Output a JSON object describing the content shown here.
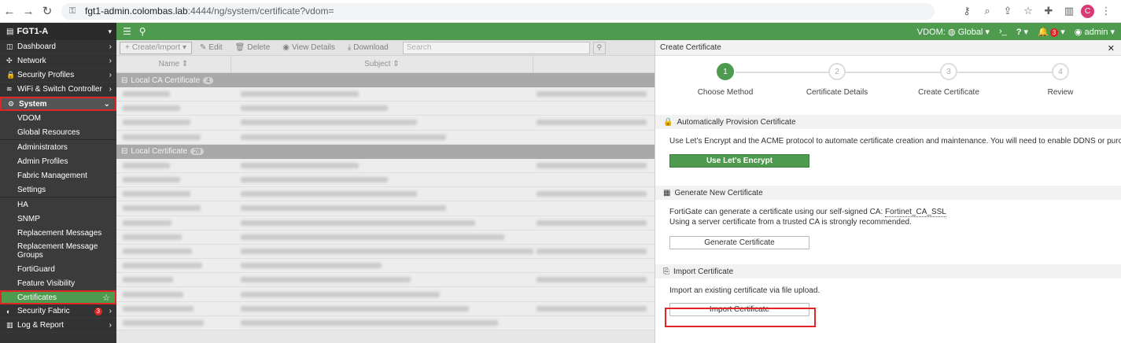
{
  "browser": {
    "url_host": "fgt1-admin.colombas.lab",
    "url_path": ":4444/ng/system/certificate?vdom=",
    "profile_initial": "C"
  },
  "topbar": {
    "device_name": "FGT1-A",
    "vdom_label": "VDOM:",
    "vdom_value": "Global",
    "cli_symbol": "›_",
    "help_symbol": "?",
    "notifications_count": "3",
    "user": "admin"
  },
  "sidebar": {
    "top_items": [
      {
        "label": "Dashboard"
      },
      {
        "label": "Network"
      },
      {
        "label": "Security Profiles"
      },
      {
        "label": "WiFi & Switch Controller"
      }
    ],
    "system_label": "System",
    "system_items": [
      "VDOM",
      "Global Resources",
      "Administrators",
      "Admin Profiles",
      "Fabric Management",
      "Settings",
      "HA",
      "SNMP",
      "Replacement Messages",
      "Replacement Message Groups",
      "FortiGuard",
      "Feature Visibility",
      "Certificates"
    ],
    "security_fabric_label": "Security Fabric",
    "security_fabric_badge": "3",
    "log_report_label": "Log & Report"
  },
  "toolbar": {
    "create_import": "Create/Import",
    "edit": "Edit",
    "delete": "Delete",
    "view_details": "View Details",
    "download": "Download",
    "search_placeholder": "Search"
  },
  "table": {
    "col_name": "Name",
    "col_subject": "Subject",
    "group1_label": "Local CA Certificate",
    "group1_count": "4",
    "group2_label": "Local Certificate",
    "group2_count": "28"
  },
  "panel": {
    "title": "Create Certificate",
    "steps": [
      {
        "num": "1",
        "label": "Choose Method"
      },
      {
        "num": "2",
        "label": "Certificate Details"
      },
      {
        "num": "3",
        "label": "Create Certificate"
      },
      {
        "num": "4",
        "label": "Review"
      }
    ],
    "auto": {
      "heading": "Automatically Provision Certificate",
      "text": "Use Let's Encrypt and the ACME protocol to automate certificate creation and maintenance. You will need to enable DDNS or purchase a domain.",
      "button": "Use Let's Encrypt"
    },
    "generate": {
      "heading": "Generate New Certificate",
      "text_prefix": "FortiGate can generate a certificate using our self-signed CA: ",
      "ca_name": "Fortinet_CA_SSL",
      "text_line2": "Using a server certificate from a trusted CA is strongly recommended.",
      "button": "Generate Certificate"
    },
    "import": {
      "heading": "Import Certificate",
      "text": "Import an existing certificate via file upload.",
      "button": "Import Certificate"
    }
  },
  "colors": {
    "accent_green": "#4e9a4e",
    "highlight_red": "#e02525",
    "sidebar_bg": "#333333"
  }
}
